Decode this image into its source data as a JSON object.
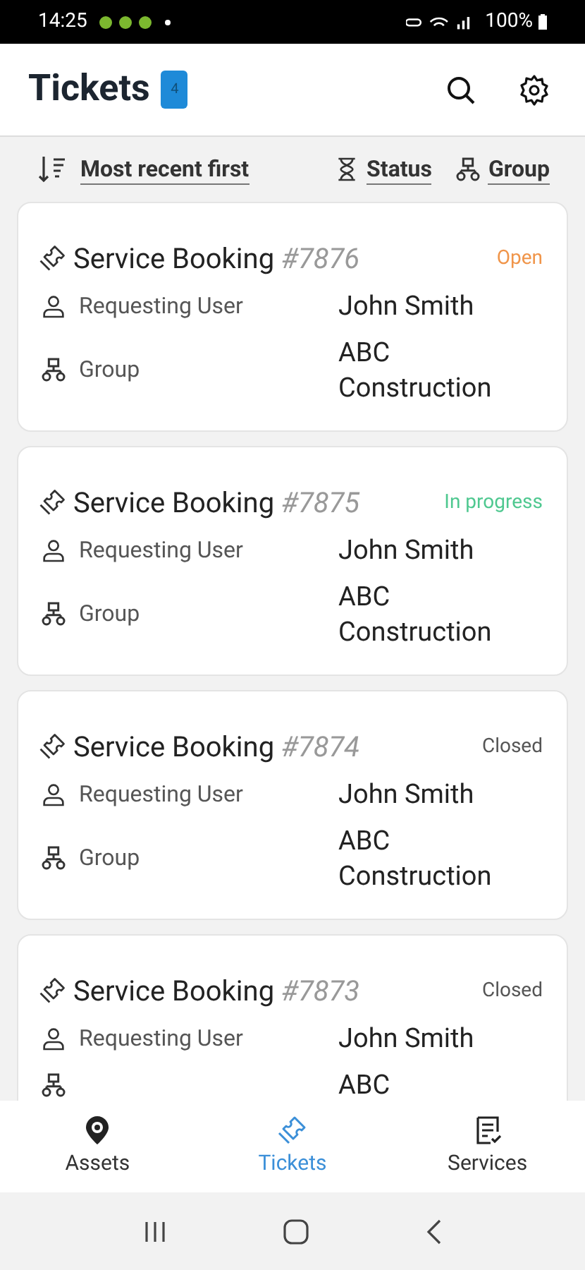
{
  "status_bar": {
    "time": "14:25",
    "battery": "100%"
  },
  "header": {
    "title": "Tickets",
    "badge": "4"
  },
  "sort_bar": {
    "sort": "Most recent first",
    "filters": [
      {
        "kind": "status",
        "label": "Status"
      },
      {
        "kind": "group",
        "label": "Group"
      }
    ]
  },
  "tickets": [
    {
      "title": "Service Booking",
      "number": "#7876",
      "status": "Open",
      "kind": "open",
      "fields": [
        {
          "kind": "user",
          "label": "Requesting User",
          "value": "John Smith"
        },
        {
          "kind": "group",
          "label": "Group",
          "value": "ABC Construction"
        }
      ]
    },
    {
      "title": "Service Booking",
      "number": "#7875",
      "status": "In progress",
      "kind": "in_progress",
      "fields": [
        {
          "kind": "user",
          "label": "Requesting User",
          "value": "John Smith"
        },
        {
          "kind": "group",
          "label": "Group",
          "value": "ABC Construction"
        }
      ]
    },
    {
      "title": "Service Booking",
      "number": "#7874",
      "status": "Closed",
      "kind": "closed",
      "fields": [
        {
          "kind": "user",
          "label": "Requesting User",
          "value": "John Smith"
        },
        {
          "kind": "group",
          "label": "Group",
          "value": "ABC Construction"
        }
      ]
    },
    {
      "title": "Service Booking",
      "number": "#7873",
      "status": "Closed",
      "kind": "closed",
      "fields": [
        {
          "kind": "user",
          "label": "Requesting User",
          "value": "John Smith"
        },
        {
          "kind": "group",
          "value": "ABC"
        }
      ]
    }
  ],
  "bottom_nav": [
    {
      "kind": "assets",
      "label": "Assets",
      "selected": false
    },
    {
      "kind": "tickets",
      "label": "Tickets",
      "selected": true
    },
    {
      "kind": "services",
      "label": "Services",
      "selected": false
    }
  ]
}
